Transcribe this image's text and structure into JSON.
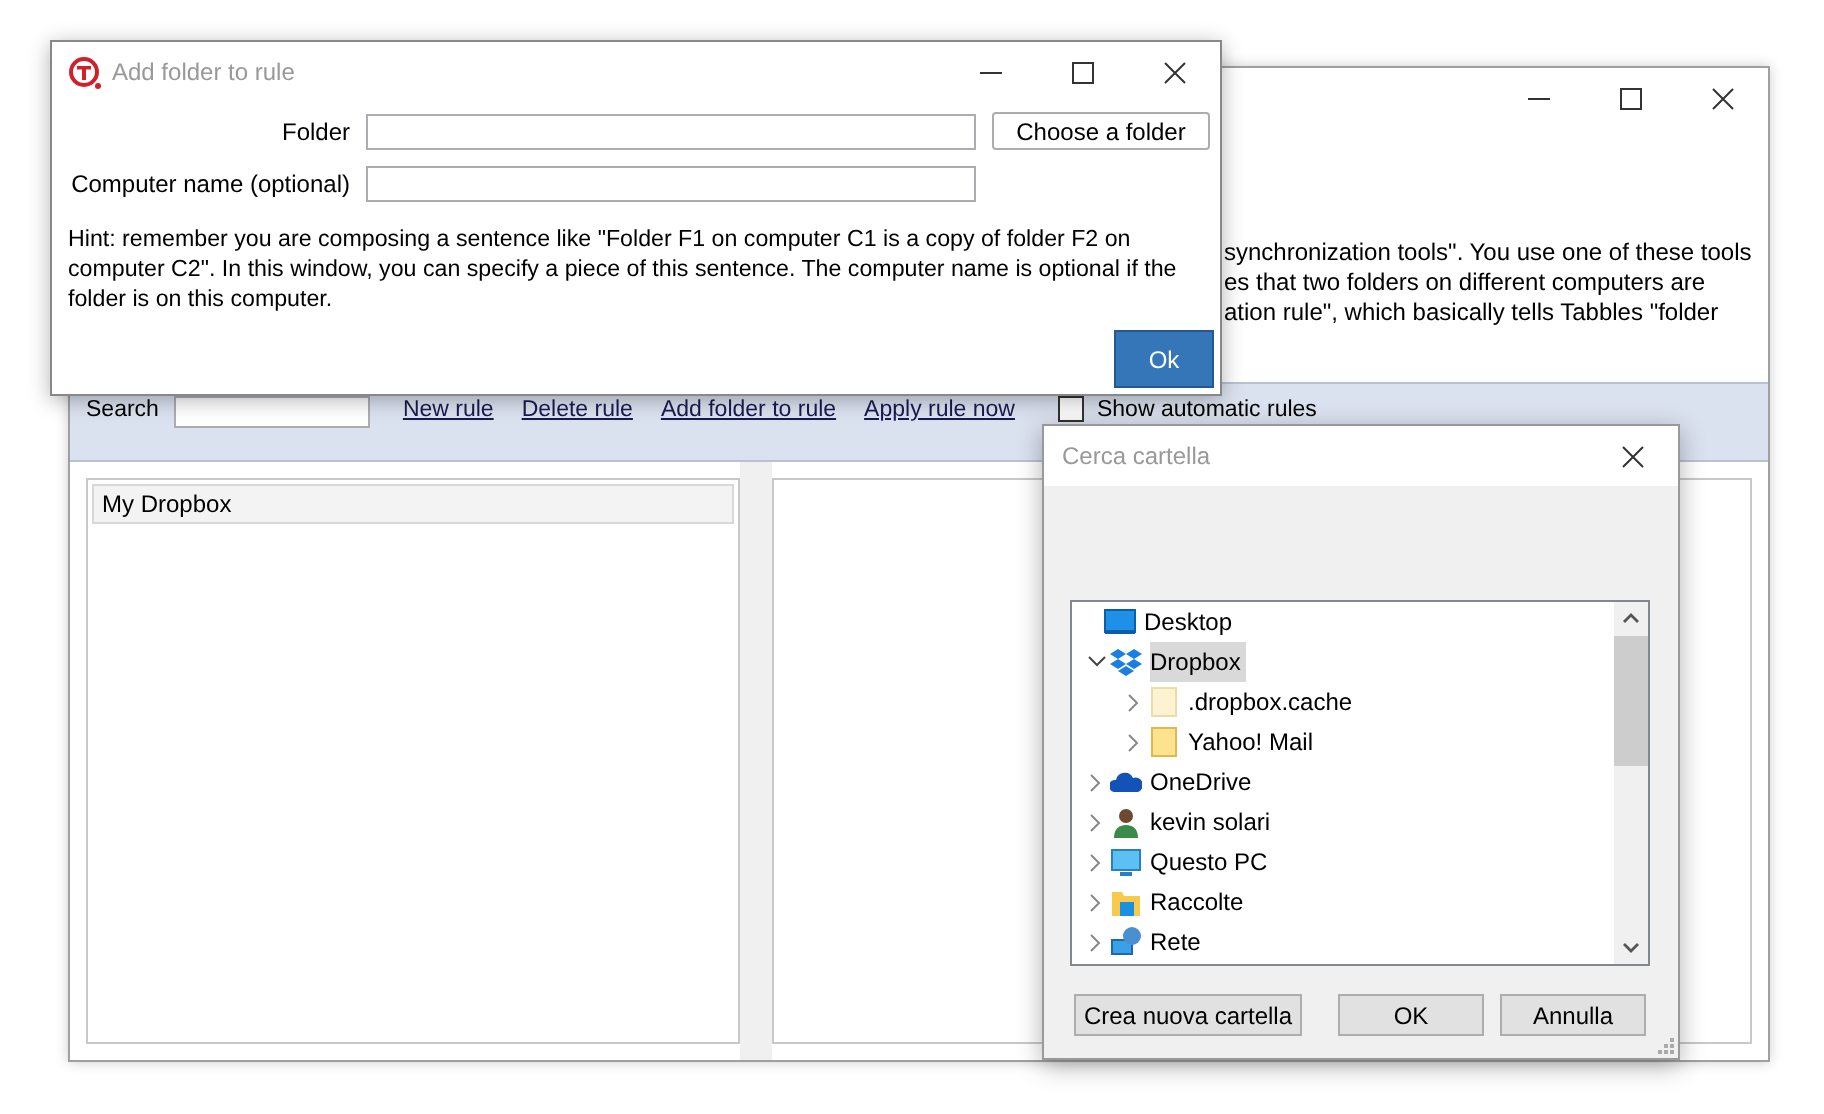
{
  "main_window": {
    "text_lines": [
      "synchronization tools\". You use one of these tools",
      "es that two folders on different computers are",
      "ation rule\", which basically tells Tabbles \"folder"
    ],
    "toolbar": {
      "search_label": "Search",
      "links": [
        "New rule",
        "Delete rule",
        "Add folder to rule",
        "Apply rule now"
      ],
      "checkbox": {
        "label": "Show automatic rules",
        "checked": false
      }
    },
    "rules_list": [
      {
        "label": "My Dropbox",
        "selected": true
      }
    ]
  },
  "add_folder_dialog": {
    "title": "Add folder to rule",
    "fields": [
      {
        "label": "Folder"
      },
      {
        "label": "Computer name (optional)"
      }
    ],
    "choose_button": "Choose a folder",
    "hint": "Hint: remember you are composing a sentence like \"Folder F1 on computer C1 is a copy of folder F2 on computer C2\". In this window, you can specify a piece of this sentence. The computer name is optional if the folder is on this computer.",
    "ok_button": "Ok"
  },
  "folder_dialog": {
    "title": "Cerca cartella",
    "tree": [
      {
        "label": "Desktop",
        "kind": "desktop",
        "selected": false,
        "children": [
          {
            "label": "Dropbox",
            "kind": "dropbox",
            "expanded": true,
            "selected": true,
            "children": [
              {
                "label": ".dropbox.cache",
                "kind": "hidden-folder",
                "expanded": false,
                "selected": false
              },
              {
                "label": "Yahoo! Mail",
                "kind": "folder",
                "expanded": false,
                "selected": false
              }
            ]
          },
          {
            "label": "OneDrive",
            "kind": "cloud",
            "expanded": false,
            "selected": false
          },
          {
            "label": "kevin solari",
            "kind": "user",
            "expanded": false,
            "selected": false
          },
          {
            "label": "Questo PC",
            "kind": "pc",
            "expanded": false,
            "selected": false
          },
          {
            "label": "Raccolte",
            "kind": "library",
            "expanded": false,
            "selected": false
          },
          {
            "label": "Rete",
            "kind": "network",
            "expanded": false,
            "selected": false
          }
        ]
      }
    ],
    "buttons": [
      "Crea nuova cartella",
      "OK",
      "Annulla"
    ]
  }
}
